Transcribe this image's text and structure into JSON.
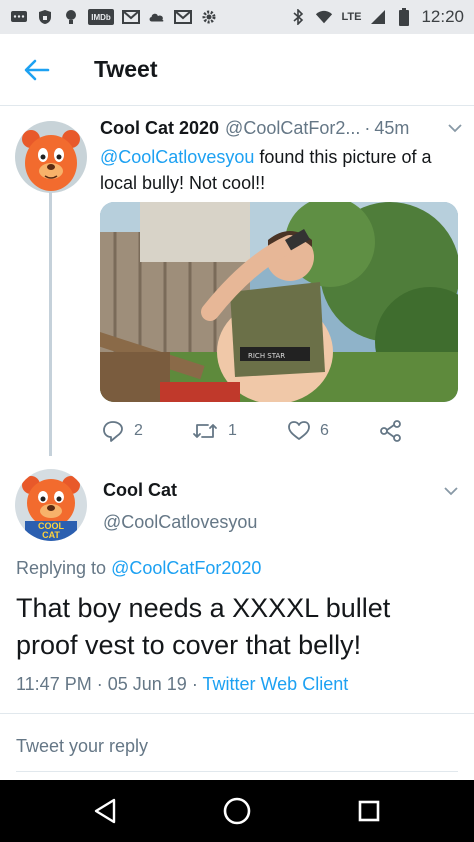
{
  "status_bar": {
    "icons": [
      "sms-icon",
      "lock-icon",
      "lightbulb-icon",
      "imdb-icon",
      "gmail-icon",
      "cloud-icon",
      "gmail-icon",
      "settings-icon"
    ],
    "imdb_text": "IMDb",
    "network": "LTE",
    "time": "12:20"
  },
  "header": {
    "title": "Tweet"
  },
  "tweet1": {
    "author_name": "Cool Cat 2020",
    "author_handle": "@CoolCatFor2...",
    "time": "45m",
    "mention": "@CoolCatlovesyou",
    "text": " found this picture of a local bully! Not cool!!",
    "replies": "2",
    "retweets": "1",
    "likes": "6"
  },
  "tweet2": {
    "author_name": "Cool Cat",
    "author_handle": "@CoolCatlovesyou",
    "avatar_badge": "COOL CAT",
    "replying_prefix": "Replying to ",
    "replying_to": "@CoolCatFor2020",
    "text": "That boy needs a XXXXL bullet proof vest to cover that belly!",
    "time": "11:47 PM",
    "date": "05 Jun 19",
    "client": "Twitter Web Client"
  },
  "reply": {
    "placeholder": "Tweet your reply"
  },
  "colors": {
    "accent": "#1da1f2",
    "muted": "#657786",
    "divider": "#e1e8ed"
  }
}
